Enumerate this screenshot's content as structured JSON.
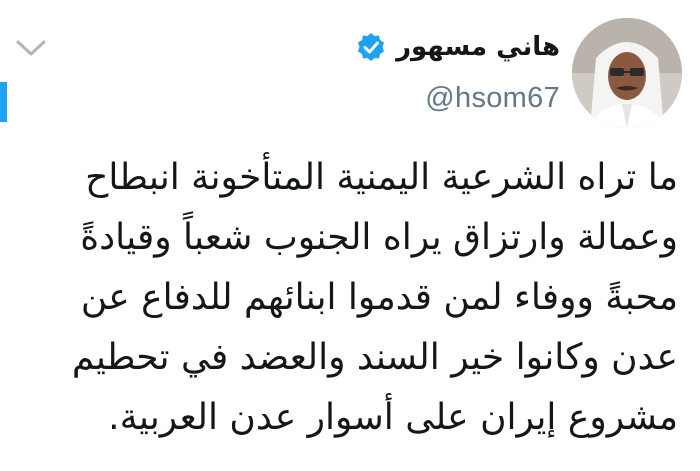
{
  "tweet": {
    "display_name": "هاني مسهور",
    "handle": "@hsom67",
    "verified": true,
    "text_lines": [
      "ما تراه الشرعية اليمنية المتأخونة انبطاح",
      "وعمالة وارتزاق يراه الجنوب شعباً وقيادةً",
      "محبةً ووفاء لمن قدموا ابنائهم للدفاع عن",
      "عدن وكانوا خير السند والعضد في تحطيم",
      "مشروع إيران على أسوار عدن العربية."
    ]
  },
  "icons": {
    "menu": "chevron-down-icon",
    "verified": "verified-badge-icon"
  },
  "colors": {
    "accent": "#1da1f2",
    "handle": "#657786",
    "text": "#14171a",
    "caret": "#aab8c2"
  }
}
